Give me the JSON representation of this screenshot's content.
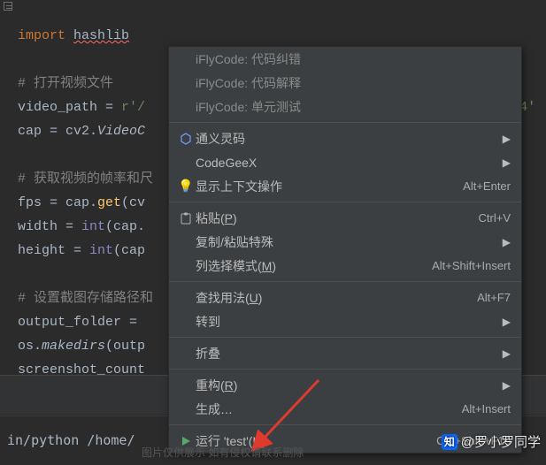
{
  "code": {
    "l0": "import",
    "l0b": "hashlib",
    "l2": "# 打开视频文件",
    "l3a": "video_path = ",
    "l3b": "r'/",
    "l3c": "4'",
    "l4a": "cap = cv2.",
    "l4b": "VideoC",
    "l6": "# 获取视频的帧率和尺",
    "l7a": "fps = cap.",
    "l7b": "get",
    "l7c": "(cv",
    "l8a": "width = ",
    "l8b": "int",
    "l8c": "(cap.",
    "l9a": "height = ",
    "l9b": "int",
    "l9c": "(cap",
    "l11": "# 设置截图存储路径和",
    "l12": "output_folder =",
    "l13a": "os.",
    "l13b": "makedirs",
    "l13c": "(outp",
    "l14": "screenshot_count"
  },
  "runbar": "in/python /home/",
  "menu": {
    "ifly1": "iFlyCode: 代码纠错",
    "ifly2": "iFlyCode: 代码解释",
    "ifly3": "iFlyCode: 单元测试",
    "tongyi": "通义灵码",
    "codegeex": "CodeGeeX",
    "context": "显示上下文操作",
    "context_sc": "Alt+Enter",
    "paste": "粘贴(",
    "paste_u": "P",
    "paste2": ")",
    "paste_sc": "Ctrl+V",
    "pastespecial": "复制/粘贴特殊",
    "colsel": "列选择模式(",
    "colsel_u": "M",
    "colsel2": ")",
    "colsel_sc": "Alt+Shift+Insert",
    "findusage": "查找用法(",
    "findusage_u": "U",
    "findusage2": ")",
    "findusage_sc": "Alt+F7",
    "goto": "转到",
    "fold": "折叠",
    "refactor": "重构(",
    "refactor_u": "R",
    "refactor2": ")",
    "generate": "生成…",
    "generate_sc": "Alt+Insert",
    "run": "运行 'test'(",
    "run_u": "U",
    "run2": ")",
    "run_sc": "Ctrl+Shift+F10"
  },
  "watermark": "@罗小罗同学",
  "zhi": "知",
  "footer": "图片仅供展示 如有侵权请联系删除"
}
